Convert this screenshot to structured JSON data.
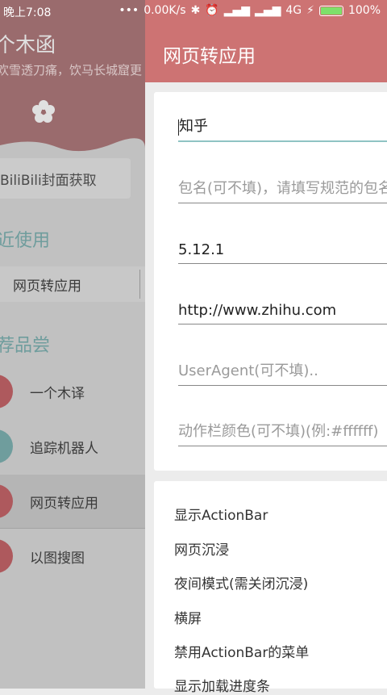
{
  "status_bar": {
    "time": "晚上7:08",
    "speed": "0.00K/s",
    "network": "4G",
    "battery": "100%"
  },
  "drawer": {
    "app_name": "个木函",
    "tagline": "欢雪透刀痛，饮马长城窟更",
    "cover_button": "BiliBili封面获取",
    "recent_title": "近使用",
    "recent_items": [
      {
        "label": "网页转应用"
      }
    ],
    "recommend_title": "荐品尝",
    "recommend_items": [
      {
        "label": "一个木译",
        "color": "#c7666a"
      },
      {
        "label": "追踪机器人",
        "color": "#7fb3b3"
      },
      {
        "label": "网页转应用",
        "color": "#c7666a"
      },
      {
        "label": "以图搜图",
        "color": "#c7666a"
      }
    ]
  },
  "main": {
    "title": "网页转应用",
    "fields": [
      {
        "value": "知乎",
        "placeholder": ""
      },
      {
        "value": "",
        "placeholder": "包名(可不填)，请填写规范的包名"
      },
      {
        "value": "5.12.1",
        "placeholder": ""
      },
      {
        "value": "http://www.zhihu.com",
        "placeholder": ""
      },
      {
        "value": "",
        "placeholder": "UserAgent(可不填).."
      },
      {
        "value": "",
        "placeholder": "动作栏颜色(可不填)(例:#ffffff)"
      }
    ],
    "options": [
      {
        "label": "显示ActionBar"
      },
      {
        "label": "网页沉浸"
      },
      {
        "label": "夜间模式(需关闭沉浸)"
      },
      {
        "label": "横屏"
      },
      {
        "label": "禁用ActionBar的菜单"
      },
      {
        "label": "显示加载进度条"
      }
    ]
  },
  "colors": {
    "toolbar": "#cd7373",
    "accent": "#8fc3c3"
  }
}
